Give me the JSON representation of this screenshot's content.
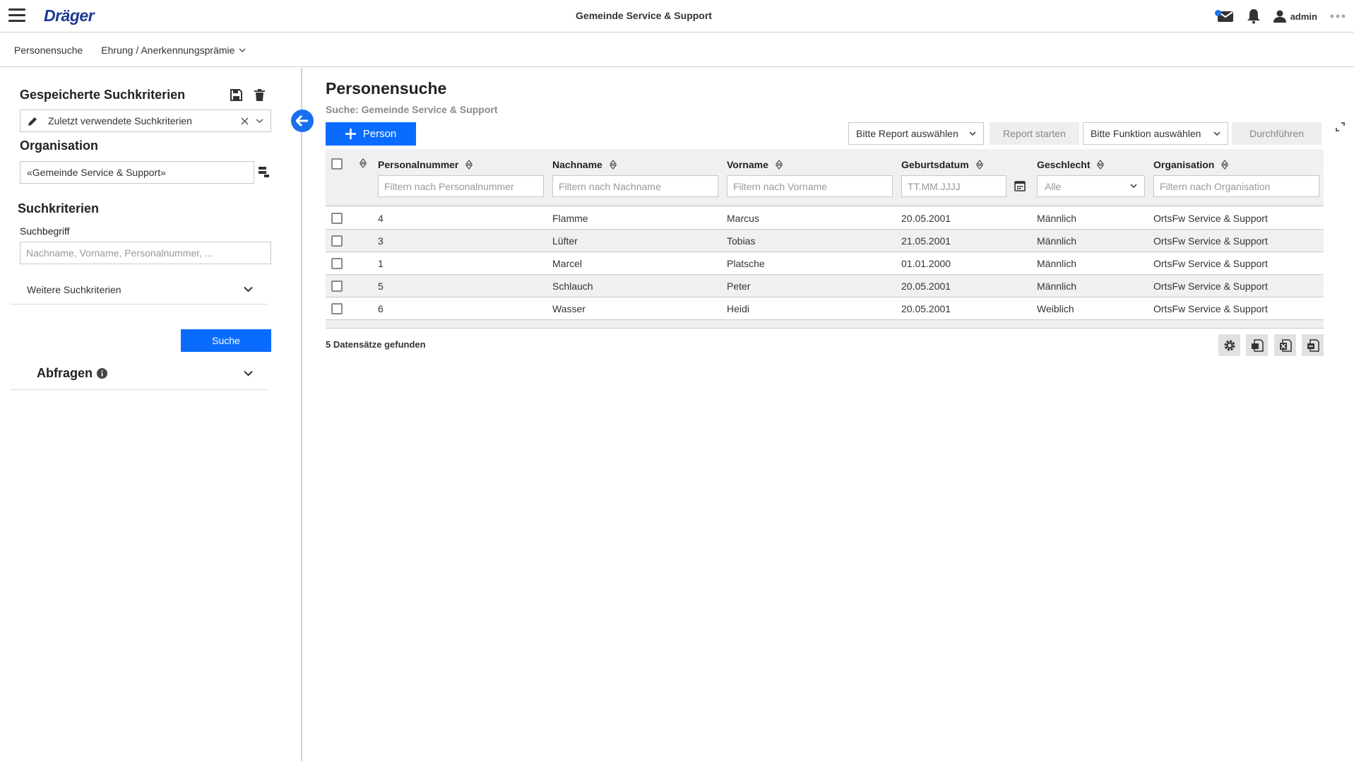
{
  "header": {
    "logo": "Dräger",
    "title": "Gemeinde Service & Support",
    "user": "admin"
  },
  "subnav": {
    "items": [
      "Personensuche",
      "Ehrung / Anerkennungsprämie"
    ]
  },
  "left": {
    "saved_heading": "Gespeicherte Suchkriterien",
    "saved_select": "Zuletzt verwendete Suchkriterien",
    "org_heading": "Organisation",
    "org_value": "«Gemeinde Service & Support»",
    "criteria_heading": "Suchkriterien",
    "search_label": "Suchbegriff",
    "search_placeholder": "Nachname, Vorname, Personalnummer, ...",
    "more_criteria": "Weitere Suchkriterien",
    "search_button": "Suche",
    "queries_heading": "Abfragen"
  },
  "main": {
    "title": "Personensuche",
    "subtitle": "Suche: Gemeinde Service & Support",
    "add_button": "Person",
    "report_select": "Bitte Report auswählen",
    "report_start": "Report starten",
    "function_select": "Bitte Funktion auswählen",
    "execute": "Durchführen",
    "count": "5 Datensätze gefunden"
  },
  "table": {
    "columns": [
      "Personalnummer",
      "Nachname",
      "Vorname",
      "Geburtsdatum",
      "Geschlecht",
      "Organisation"
    ],
    "filters": {
      "personalnummer": "Filtern nach Personalnummer",
      "nachname": "Filtern nach Nachname",
      "vorname": "Filtern nach Vorname",
      "geburtsdatum": "TT.MM.JJJJ",
      "geschlecht": "Alle",
      "organisation": "Filtern nach Organisation"
    },
    "rows": [
      [
        "4",
        "Flamme",
        "Marcus",
        "20.05.2001",
        "Männlich",
        "OrtsFw Service & Support"
      ],
      [
        "3",
        "Lüfter",
        "Tobias",
        "21.05.2001",
        "Männlich",
        "OrtsFw Service & Support"
      ],
      [
        "1",
        "Marcel",
        "Platsche",
        "01.01.2000",
        "Männlich",
        "OrtsFw Service & Support"
      ],
      [
        "5",
        "Schlauch",
        "Peter",
        "20.05.2001",
        "Männlich",
        "OrtsFw Service & Support"
      ],
      [
        "6",
        "Wasser",
        "Heidi",
        "20.05.2001",
        "Weiblich",
        "OrtsFw Service & Support"
      ]
    ]
  },
  "colors": {
    "accent": "#0a6cff",
    "brand": "#1b3a8f",
    "row_alt": "#f0f0f0"
  },
  "icons": [
    "menu-icon",
    "mail-icon",
    "bell-icon",
    "user-icon",
    "more-icon",
    "save-icon",
    "trash-icon",
    "pencil-icon",
    "clear-icon",
    "chevron-down-icon",
    "org-tree-icon",
    "arrow-left-icon",
    "info-icon",
    "plus-icon",
    "sort-icon",
    "calendar-icon",
    "gear-icon",
    "export-pdf-icon",
    "export-excel-icon",
    "export-csv-icon",
    "expand-icon"
  ]
}
